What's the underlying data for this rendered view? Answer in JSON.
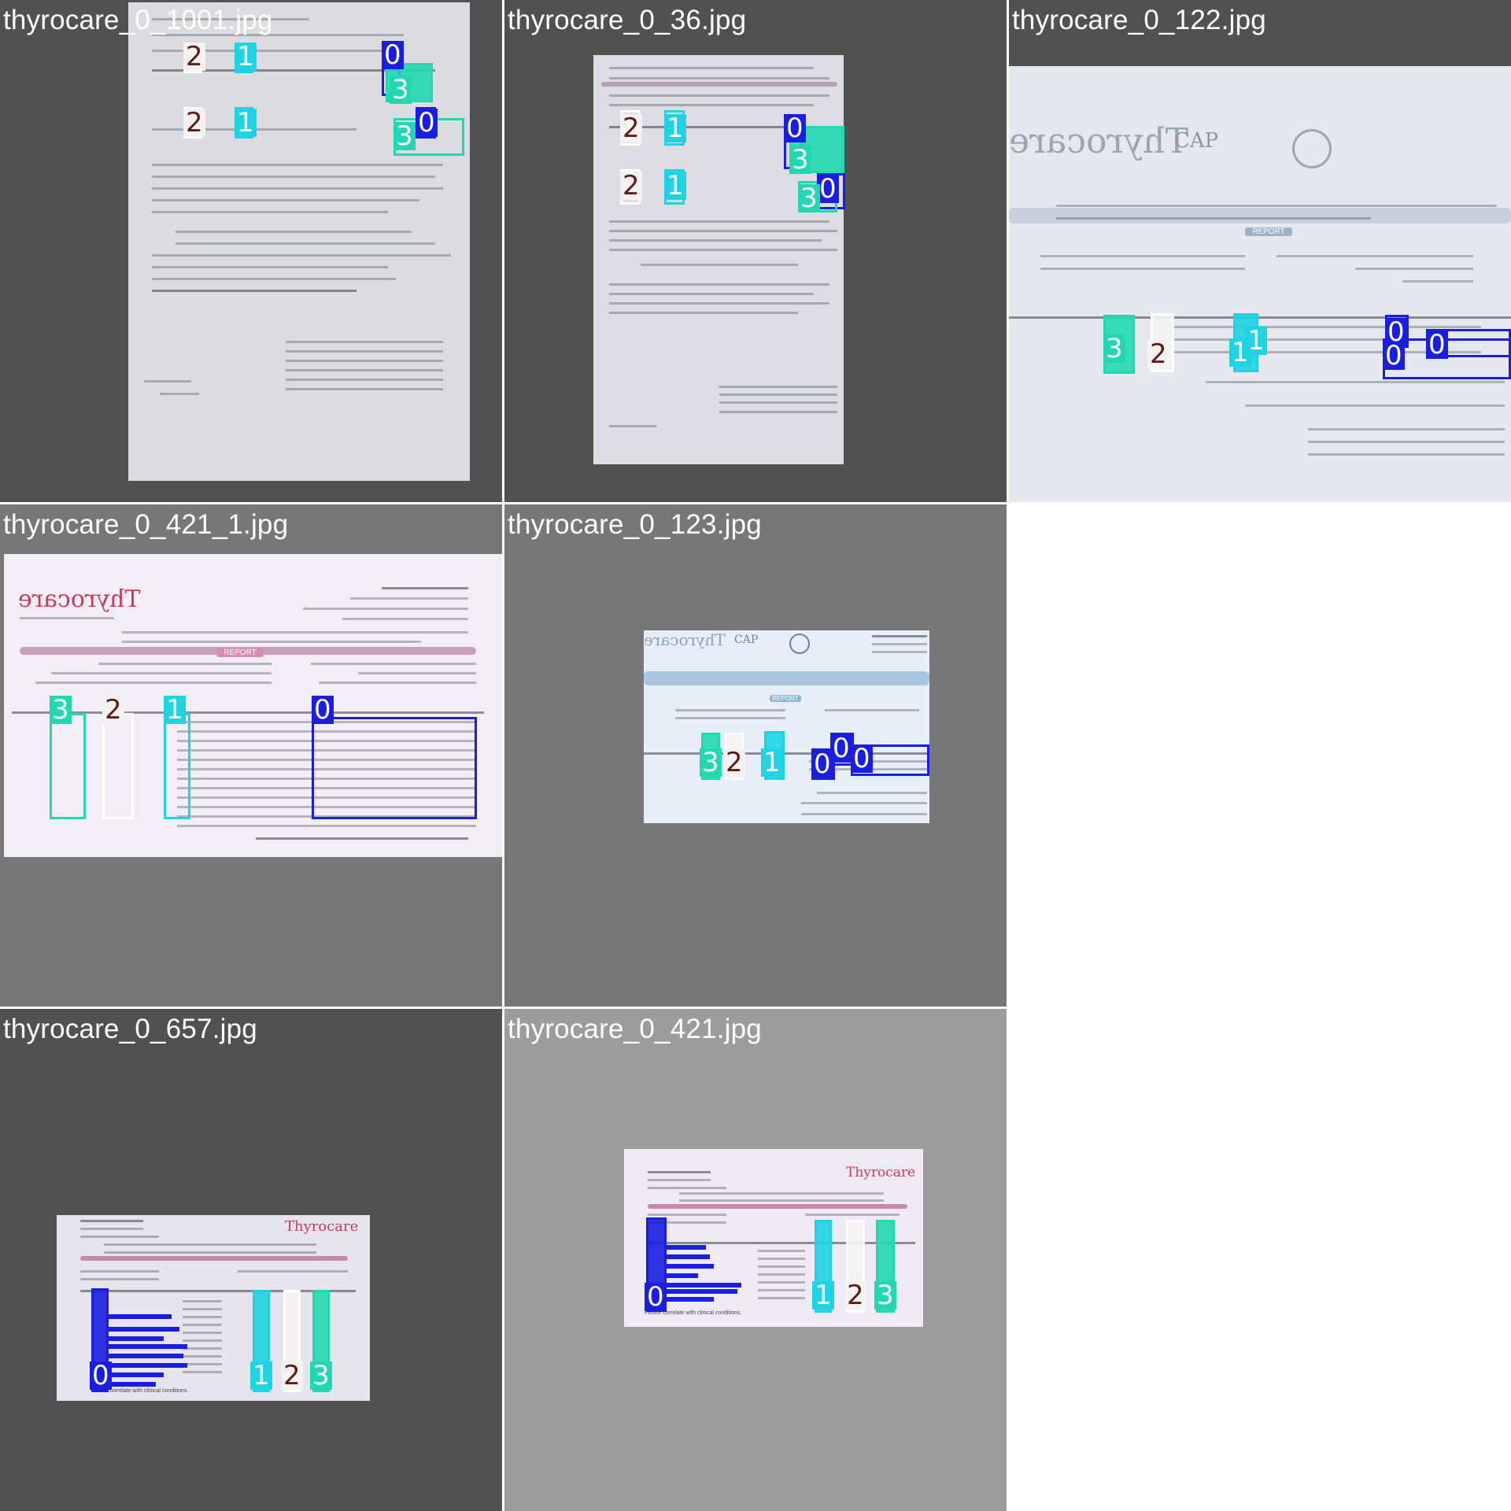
{
  "tiles": [
    {
      "id": "t1",
      "title": "thyrocare_0_1001.jpg"
    },
    {
      "id": "t2",
      "title": "thyrocare_0_36.jpg"
    },
    {
      "id": "t3",
      "title": "thyrocare_0_122.jpg"
    },
    {
      "id": "t4",
      "title": "thyrocare_0_421_1.jpg"
    },
    {
      "id": "t5",
      "title": "thyrocare_0_123.jpg"
    },
    {
      "id": "t6",
      "title": "thyrocare_0_657.jpg"
    },
    {
      "id": "t7",
      "title": "thyrocare_0_421.jpg"
    }
  ],
  "class_labels": {
    "c0": "0",
    "c1": "1",
    "c2": "2",
    "c3": "3"
  },
  "colors": {
    "class0": "#1a1ee0",
    "class1": "#1fd3e3",
    "class2": "#ffffff",
    "class3": "#22d8b0",
    "tile_bg_dark": "#515151",
    "tile_bg_mid": "#777777",
    "tile_bg_light": "#9c9c9c",
    "label_text_class2": "#5a1f12"
  },
  "doc_text": {
    "brand": "Thyrocare",
    "cap": "CAP",
    "report": "REPORT",
    "correlate": "Please correlate with clinical conditions."
  }
}
